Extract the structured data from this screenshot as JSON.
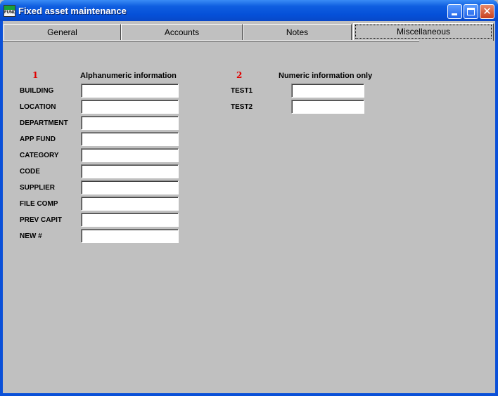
{
  "window": {
    "title": "Fixed asset maintenance",
    "icon_text": "FUND"
  },
  "tabs": [
    {
      "label": "General"
    },
    {
      "label": "Accounts"
    },
    {
      "label": "Notes"
    },
    {
      "label": "Miscellaneous"
    }
  ],
  "group1": {
    "number": "1",
    "title": "Alphanumeric information",
    "fields": [
      {
        "label": "BUILDING",
        "value": ""
      },
      {
        "label": "LOCATION",
        "value": ""
      },
      {
        "label": "DEPARTMENT",
        "value": ""
      },
      {
        "label": "APP FUND",
        "value": ""
      },
      {
        "label": "CATEGORY",
        "value": ""
      },
      {
        "label": "CODE",
        "value": ""
      },
      {
        "label": "SUPPLIER",
        "value": ""
      },
      {
        "label": "FILE COMP",
        "value": ""
      },
      {
        "label": "PREV CAPIT",
        "value": ""
      },
      {
        "label": "NEW #",
        "value": ""
      }
    ]
  },
  "group2": {
    "number": "2",
    "title": "Numeric information only",
    "fields": [
      {
        "label": "TEST1",
        "value": ""
      },
      {
        "label": "TEST2",
        "value": ""
      }
    ]
  },
  "colors": {
    "titlebar": "#0550d8",
    "face": "#c0c0c0",
    "group_number": "#e00000"
  },
  "icons": [
    "app-icon",
    "minimize-icon",
    "maximize-icon",
    "close-icon"
  ]
}
